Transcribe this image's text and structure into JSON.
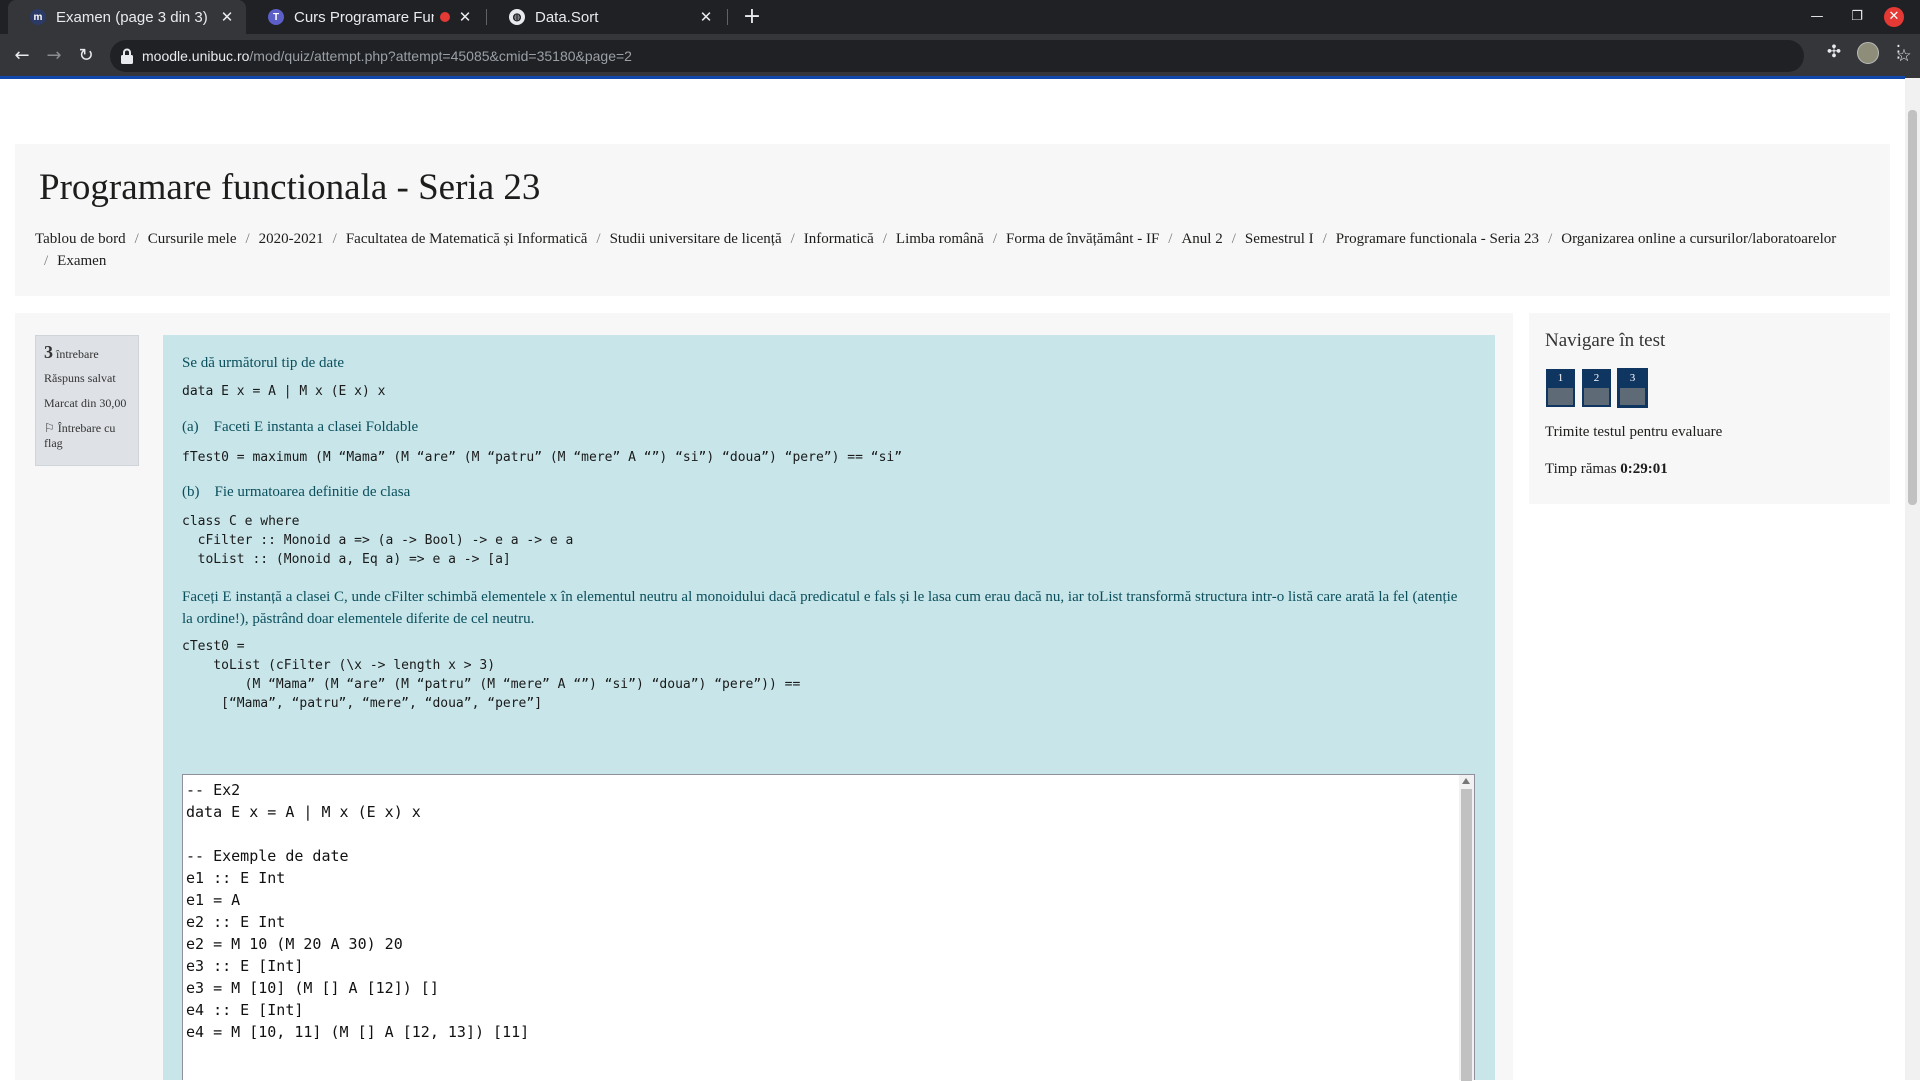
{
  "browser": {
    "tabs": [
      {
        "title": "Examen (page 3 din 3)",
        "favicon": "moodle-favicon",
        "active": true
      },
      {
        "title": "Curs Programare Func",
        "favicon": "teams-favicon",
        "recording": true
      },
      {
        "title": "Data.Sort",
        "favicon": "globe-icon"
      }
    ],
    "url_host": "moodle.unibuc.ro",
    "url_path": "/mod/quiz/attempt.php?attempt=45085&cmid=35180&page=2"
  },
  "page": {
    "title": "Programare functionala - Seria 23",
    "breadcrumb": [
      "Tablou de bord",
      "Cursurile mele",
      "2020-2021",
      "Facultatea de Matematică și Informatică",
      "Studii universitare de licență",
      "Informatică",
      "Limba română",
      "Forma de învățământ - IF",
      "Anul 2",
      "Semestrul I",
      "Programare functionala - Seria 23",
      "Organizarea online a cursurilor/laboratoarelor",
      "Examen"
    ]
  },
  "question_info": {
    "number": "3",
    "label": "întrebare",
    "status": "Răspuns salvat",
    "mark": "Marcat din 30,00",
    "flag": "Întrebare cu flag"
  },
  "question": {
    "intro": "Se dă următorul tip de date",
    "code_type": "data E x = A | M x (E x) x",
    "part_a": "(a)    Faceti E instanta a clasei Foldable",
    "code_a": "fTest0 = maximum (M “Mama” (M “are” (M “patru” (M “mere” A “”) “si”) “doua”) “pere”) == “si”",
    "part_b": "(b)    Fie urmatoarea definitie de clasa",
    "code_b": "class C e where\n  cFilter :: Monoid a => (a -> Bool) -> e a -> e a\n  toList :: (Monoid a, Eq a) => e a -> [a]",
    "paragraph": "Faceți E instanță a clasei C, unde cFilter schimbă elementele x în elementul neutru al monoidului dacă predicatul e fals și le lasa cum erau dacă nu, iar toList transformă structura intr-o listă care arată la fel (atenție la ordine!), păstrând doar elementele diferite de cel neutru.",
    "code_c": "cTest0 =\n    toList (cFilter (\\x -> length x > 3)\n        (M “Mama” (M “are” (M “patru” (M “mere” A “”) “si”) “doua”) “pere”)) ==\n     [“Mama”, “patru”, “mere”, “doua”, “pere”]"
  },
  "answer": {
    "text": "-- Ex2\ndata E x = A | M x (E x) x\n\n-- Exemple de date\ne1 :: E Int\ne1 = A\ne2 :: E Int\ne2 = M 10 (M 20 A 30) 20\ne3 :: E [Int]\ne3 = M [10] (M [] A [12]) []\ne4 :: E [Int]\ne4 = M [10, 11] (M [] A [12, 13]) [11]"
  },
  "nav": {
    "title": "Navigare în test",
    "buttons": [
      "1",
      "2",
      "3"
    ],
    "submit": "Trimite testul pentru evaluare",
    "time_label": "Timp rămas",
    "time_value": "0:29:01"
  }
}
